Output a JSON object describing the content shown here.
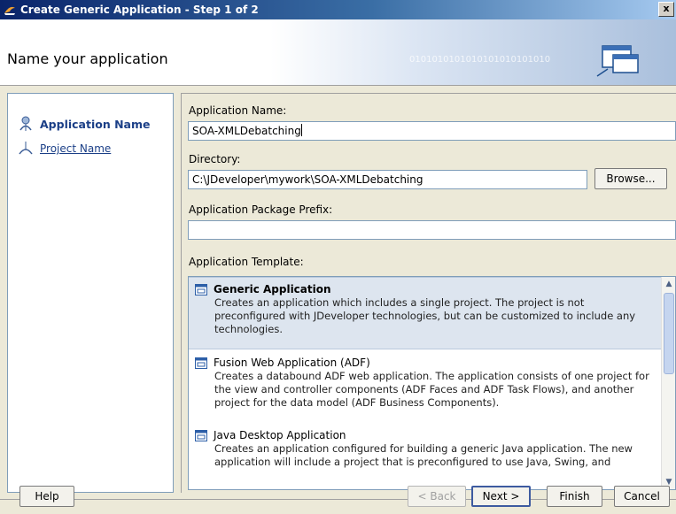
{
  "window": {
    "title": "Create Generic Application - Step 1 of 2",
    "close": "x"
  },
  "header": {
    "title": "Name your application",
    "decoration": "0101010101010101010101010"
  },
  "steps": [
    {
      "label": "Application Name",
      "active": true
    },
    {
      "label": "Project Name",
      "active": false
    }
  ],
  "form": {
    "app_name_label": "Application Name:",
    "app_name_value": "SOA-XMLDebatching",
    "directory_label": "Directory:",
    "directory_value": "C:\\JDeveloper\\mywork\\SOA-XMLDebatching",
    "browse_label": "Browse...",
    "prefix_label": "Application Package Prefix:",
    "prefix_value": "",
    "template_label": "Application Template:"
  },
  "templates": [
    {
      "name": "Generic Application",
      "selected": true,
      "description": "Creates an application which includes a single project. The project is not preconfigured with JDeveloper technologies, but can be customized to include any technologies."
    },
    {
      "name": "Fusion Web Application (ADF)",
      "selected": false,
      "description": "Creates a databound ADF web application. The application consists of one project for the view and controller components (ADF Faces and ADF Task Flows), and another project for the data model (ADF Business Components)."
    },
    {
      "name": "Java Desktop Application",
      "selected": false,
      "description": "Creates an application configured for building a generic Java application. The new application will include a project that is preconfigured to use Java, Swing, and"
    }
  ],
  "buttons": {
    "help": "Help",
    "back": "< Back",
    "next": "Next >",
    "finish": "Finish",
    "cancel": "Cancel"
  }
}
